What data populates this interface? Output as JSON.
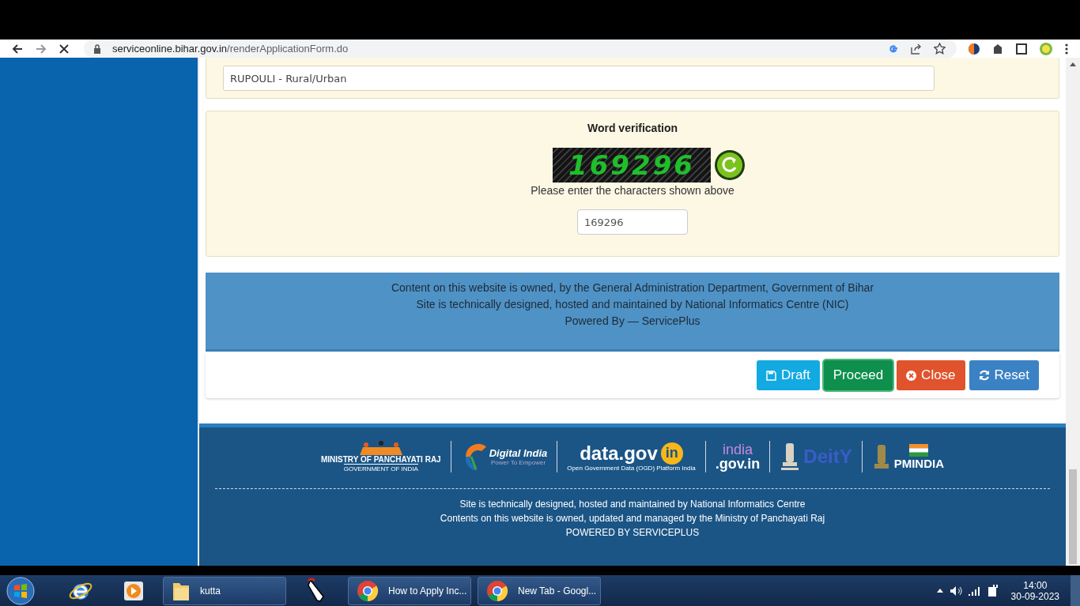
{
  "browser": {
    "url_host": "serviceonline.bihar.gov.in",
    "url_path": "/renderApplicationForm.do",
    "loading": true
  },
  "location_field": {
    "value": "RUPOULI - Rural/Urban"
  },
  "captcha": {
    "title": "Word verification",
    "image_text": "169296",
    "hint": "Please enter the characters shown above",
    "value": "169296"
  },
  "info_band": [
    "Content on this website is owned, by the General Administration Department, Government of Bihar",
    "Site is technically designed, hosted and maintained by National Informatics Centre (NIC)",
    "Powered By — ServicePlus"
  ],
  "buttons": [
    {
      "kind": "draft",
      "label": "Draft"
    },
    {
      "kind": "proceed",
      "label": "Proceed"
    },
    {
      "kind": "close",
      "label": "Close"
    },
    {
      "kind": "reset",
      "label": "Reset"
    }
  ],
  "footer": {
    "logos": [
      {
        "kind": "panchayati",
        "title": "MINISTRY OF PANCHAYATI RAJ",
        "sub": "GOVERNMENT OF INDIA"
      },
      {
        "kind": "digital",
        "title": "Digital India",
        "sub": "Power To Empower"
      },
      {
        "kind": "datagov",
        "title": "data.gov",
        "badge": "in",
        "sub": "Open Government Data (OGD) Platform India"
      },
      {
        "kind": "indiagov",
        "title": "india",
        "sub": ".gov.in"
      },
      {
        "kind": "deity",
        "title": "DeitY"
      },
      {
        "kind": "pmindia",
        "title": "PMINDIA"
      }
    ],
    "lines": [
      "Site is technically designed, hosted and maintained by National Informatics Centre",
      "Contents on this website is owned, updated and managed by the Ministry of Panchayati Raj",
      "POWERED BY SERVICEPLUS"
    ]
  },
  "taskbar": {
    "items": [
      {
        "kind": "folder",
        "label": "kutta"
      },
      {
        "kind": "cursor"
      },
      {
        "kind": "chrome",
        "label": "How to Apply Inc..."
      },
      {
        "kind": "chrome",
        "label": "New Tab - Googl..."
      }
    ],
    "time": "14:00",
    "date": "30-09-2023"
  }
}
